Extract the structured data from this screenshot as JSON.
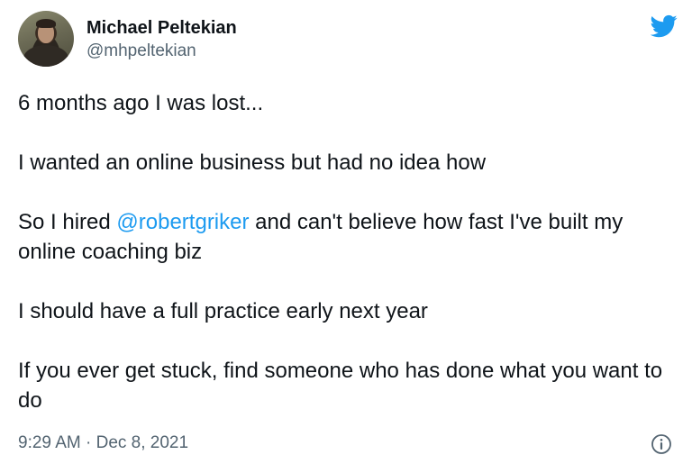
{
  "author": {
    "display_name": "Michael Peltekian",
    "handle": "@mhpeltekian"
  },
  "tweet": {
    "line1": "6 months ago I was lost...",
    "line2": "I wanted an online business but had no idea how",
    "line3_before": "So I hired ",
    "line3_mention": "@robertgriker",
    "line3_after": " and can't believe how fast I've built my online coaching biz",
    "line4": "I should have a full practice early next year",
    "line5": "If you ever get stuck, find someone who has done what you want to do"
  },
  "meta": {
    "timestamp": "9:29 AM · Dec 8, 2021"
  },
  "icons": {
    "brand": "twitter-bird-icon",
    "info": "info-icon"
  },
  "colors": {
    "brand_blue": "#1d9bf0",
    "text": "#0f1419",
    "secondary_text": "#536471"
  }
}
